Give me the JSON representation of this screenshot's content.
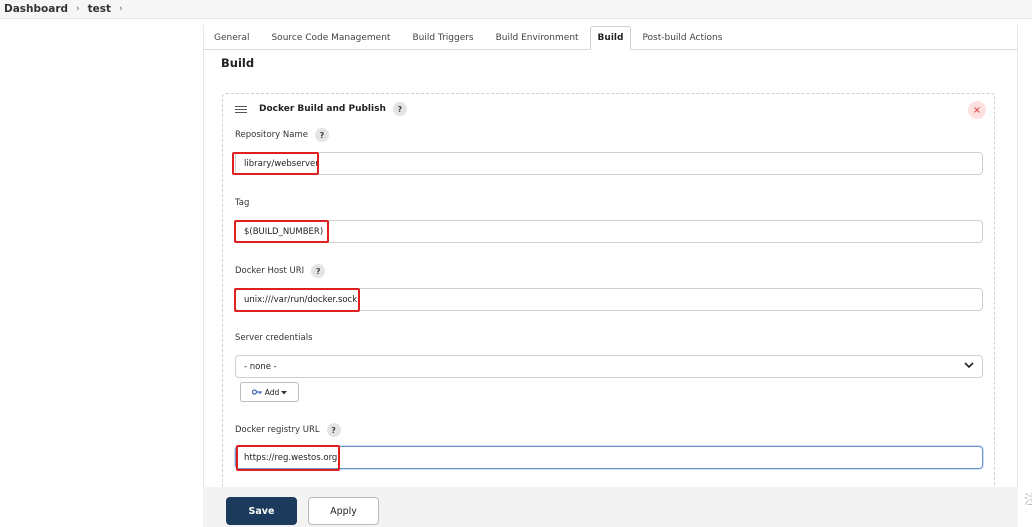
{
  "breadcrumb": {
    "items": [
      "Dashboard",
      "test"
    ],
    "separator": "›"
  },
  "tabs": [
    "General",
    "Source Code Management",
    "Build Triggers",
    "Build Environment",
    "Build",
    "Post-build Actions"
  ],
  "active_tab": "Build",
  "section_title": "Build",
  "step": {
    "title": "Docker Build and Publish",
    "help": "?",
    "close": "×"
  },
  "fields": {
    "repository_name": {
      "label": "Repository Name",
      "help": "?",
      "value": "library/webserver"
    },
    "tag": {
      "label": "Tag",
      "value": "$(BUILD_NUMBER)"
    },
    "docker_host_uri": {
      "label": "Docker Host URI",
      "help": "?",
      "value": "unix:///var/run/docker.sock"
    },
    "server_credentials": {
      "label": "Server credentials",
      "value": "- none -",
      "add_label": "Add"
    },
    "docker_registry_url": {
      "label": "Docker registry URL",
      "help": "?",
      "value": "https://reg.westos.org"
    }
  },
  "buttons": {
    "save": "Save",
    "apply": "Apply"
  },
  "edge_glyph": "注",
  "colors": {
    "save_bg": "#1b3a5c",
    "highlight": "#e02020",
    "focus_border": "#6a93c9"
  }
}
